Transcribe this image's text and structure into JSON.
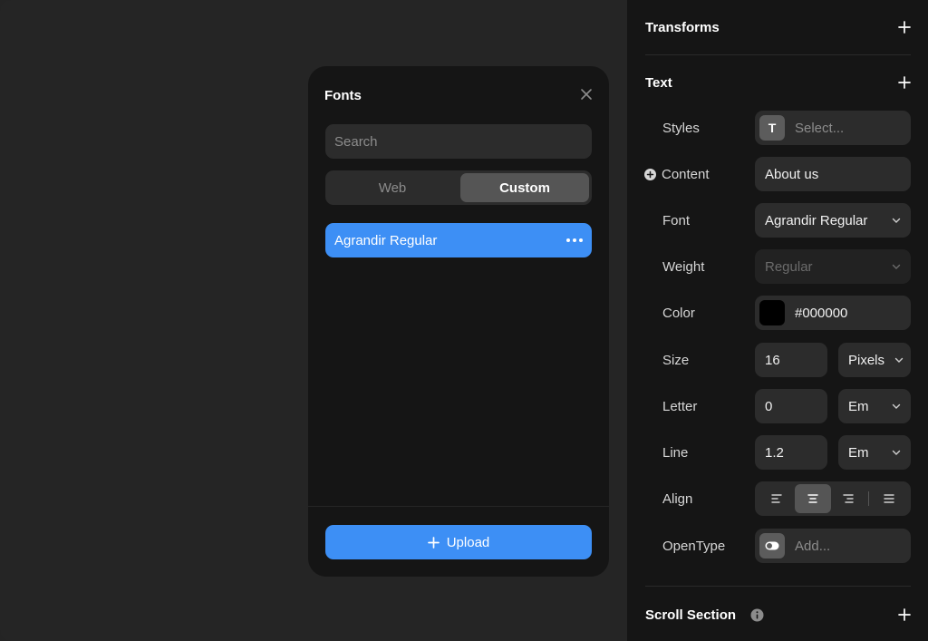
{
  "modal": {
    "title": "Fonts",
    "search_placeholder": "Search",
    "tabs": [
      {
        "label": "Web",
        "active": false
      },
      {
        "label": "Custom",
        "active": true
      }
    ],
    "fonts": [
      {
        "name": "Agrandir Regular",
        "selected": true
      }
    ],
    "upload_label": "Upload"
  },
  "panel": {
    "transforms_title": "Transforms",
    "text_title": "Text",
    "scroll_title": "Scroll Section",
    "rows": {
      "styles": {
        "label": "Styles",
        "placeholder": "Select...",
        "icon": "text-style-icon"
      },
      "content": {
        "label": "Content",
        "value": "About us"
      },
      "font": {
        "label": "Font",
        "value": "Agrandir Regular"
      },
      "weight": {
        "label": "Weight",
        "value": "Regular"
      },
      "color": {
        "label": "Color",
        "value": "#000000"
      },
      "size": {
        "label": "Size",
        "value": "16",
        "unit": "Pixels"
      },
      "letter": {
        "label": "Letter",
        "value": "0",
        "unit": "Em"
      },
      "line": {
        "label": "Line",
        "value": "1.2",
        "unit": "Em"
      },
      "align": {
        "label": "Align",
        "active": "center"
      },
      "opentype": {
        "label": "OpenType",
        "placeholder": "Add...",
        "icon": "toggle-icon"
      }
    }
  },
  "colors": {
    "accent": "#3d8ff5",
    "panel_bg": "#151515",
    "canvas_bg": "#252525",
    "field_bg": "#2c2c2c"
  }
}
